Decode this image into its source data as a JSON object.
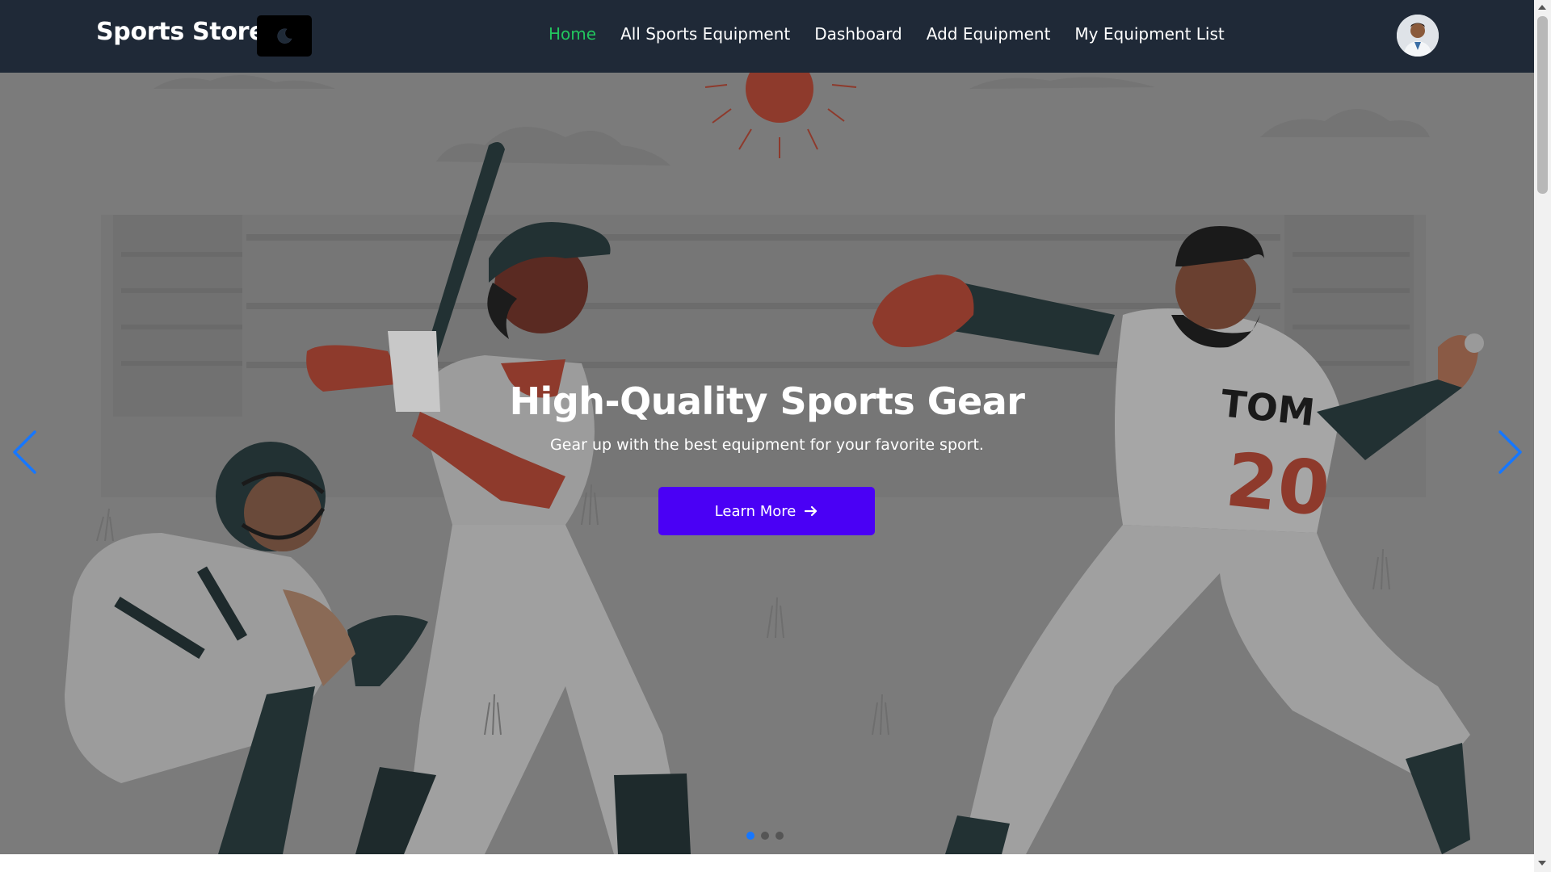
{
  "brand": {
    "name": "Sports Store"
  },
  "theme_toggle": {
    "icon": "moon-icon"
  },
  "nav": {
    "links": [
      {
        "label": "Home",
        "active": true
      },
      {
        "label": "All Sports Equipment",
        "active": false
      },
      {
        "label": "Dashboard",
        "active": false
      },
      {
        "label": "Add Equipment",
        "active": false
      },
      {
        "label": "My Equipment List",
        "active": false
      }
    ],
    "active_color": "#22c55e"
  },
  "user": {
    "avatar_icon": "user-avatar"
  },
  "hero": {
    "title": "High-Quality Sports Gear",
    "subtitle": "Gear up with the best equipment for your favorite sport.",
    "cta_label": "Learn More",
    "cta_icon": "arrow-right-icon",
    "cta_color": "#4a00f5",
    "prev_icon": "chevron-left-icon",
    "next_icon": "chevron-right-icon",
    "slide_count": 3,
    "active_slide": 1,
    "jersey_name": "TOM",
    "jersey_number": "20"
  },
  "colors": {
    "navbar": "#1f2937",
    "arrow": "#1677ff",
    "hero_bg": "#7b7b7b"
  }
}
